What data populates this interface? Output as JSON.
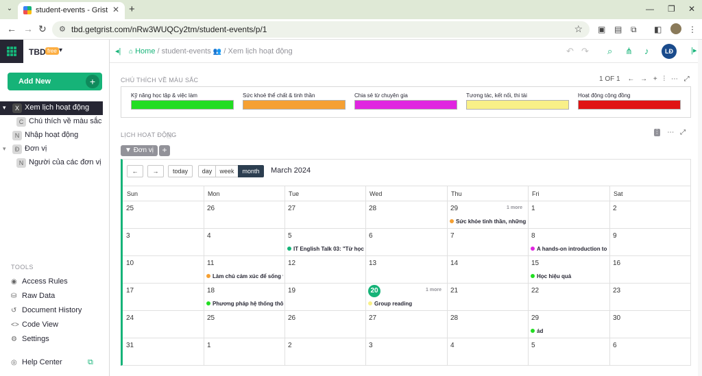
{
  "browser": {
    "tab_title": "student-events - Grist",
    "url": "tbd.getgrist.com/nRw3WUQCy2tm/student-events/p/1"
  },
  "org": {
    "name": "TBD",
    "badge": "free"
  },
  "sidebar": {
    "add_new": "Add New",
    "pages": [
      {
        "icon": "X",
        "label": "Xem lịch hoạt động",
        "selected": true,
        "caret": "▾"
      },
      {
        "icon": "C",
        "label": "Chú thích về màu sắc"
      },
      {
        "icon": "N",
        "label": "Nhập hoạt động"
      },
      {
        "icon": "Đ",
        "label": "Đơn vị",
        "caret": "▾"
      },
      {
        "icon": "N",
        "label": "Người của các đơn vị"
      }
    ],
    "tools_heading": "TOOLS",
    "tools": [
      "Access Rules",
      "Raw Data",
      "Document History",
      "Code View",
      "Settings"
    ],
    "help": "Help Center"
  },
  "topbar": {
    "home": "Home",
    "doc": "student-events",
    "page": "Xem lịch hoạt động",
    "avatar": "LĐ"
  },
  "legend_section": {
    "title": "CHÚ THÍCH VỀ MÀU SẮC",
    "pager": "1 OF 1",
    "items": [
      {
        "label": "Kỹ năng học tập & việc làm",
        "color": "#22dd22"
      },
      {
        "label": "Sức khoẻ thể chất & tinh thần",
        "color": "#f5a033"
      },
      {
        "label": "Chia sẻ từ chuyên gia",
        "color": "#e025e0"
      },
      {
        "label": "Tương tác, kết nối, thi tài",
        "color": "#f9f088"
      },
      {
        "label": "Hoạt động cộng đồng",
        "color": "#e01313"
      }
    ]
  },
  "calendar_section": {
    "title": "LỊCH HOẠT ĐỘNG",
    "filter": "Đơn vị",
    "buttons": {
      "prev": "←",
      "next": "→",
      "today": "today",
      "day": "day",
      "week": "week",
      "month": "month"
    },
    "month_title": "March 2024",
    "weekdays": [
      "Sun",
      "Mon",
      "Tue",
      "Wed",
      "Thu",
      "Fri",
      "Sat"
    ],
    "weeks": [
      [
        "25",
        "26",
        "27",
        "28",
        "29",
        "1",
        "2"
      ],
      [
        "3",
        "4",
        "5",
        "6",
        "7",
        "8",
        "9"
      ],
      [
        "10",
        "11",
        "12",
        "13",
        "14",
        "15",
        "16"
      ],
      [
        "17",
        "18",
        "19",
        "20",
        "21",
        "22",
        "23"
      ],
      [
        "24",
        "25",
        "26",
        "27",
        "28",
        "29",
        "30"
      ],
      [
        "31",
        "1",
        "2",
        "3",
        "4",
        "5",
        "6"
      ]
    ],
    "today": {
      "week": 3,
      "day": 3
    },
    "more_labels": [
      {
        "week": 0,
        "day": 4,
        "text": "1 more"
      },
      {
        "week": 3,
        "day": 3,
        "text": "1 more"
      }
    ],
    "events": [
      {
        "week": 0,
        "day": 4,
        "title": "Sức khỏe tinh thần, những",
        "color": "#f5a033"
      },
      {
        "week": 1,
        "day": 2,
        "title": "IT English Talk 03: \"Từ học",
        "color": "#16b378"
      },
      {
        "week": 1,
        "day": 5,
        "title": "A hands-on introduction to",
        "color": "#e025e0"
      },
      {
        "week": 2,
        "day": 1,
        "title": "Làm chủ cảm xúc để sống v",
        "color": "#f5a033"
      },
      {
        "week": 2,
        "day": 5,
        "title": "Học hiệu quả",
        "color": "#22dd22"
      },
      {
        "week": 3,
        "day": 1,
        "title": "Phương pháp hệ thống thô",
        "color": "#22dd22"
      },
      {
        "week": 3,
        "day": 3,
        "title": "Group reading",
        "color": "#f9f088"
      },
      {
        "week": 4,
        "day": 5,
        "title": "ád",
        "color": "#22dd22"
      }
    ]
  }
}
